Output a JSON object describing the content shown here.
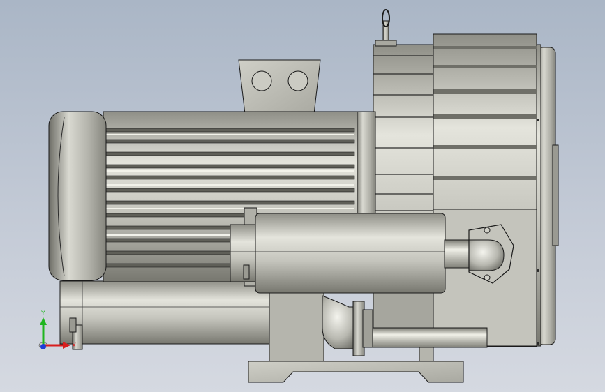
{
  "viewport": {
    "background_top": "#aab6c6",
    "background_bottom": "#d5d9e1"
  },
  "model": {
    "body_color": "#bdbdb5",
    "edge_color": "#1a1a1a"
  },
  "triad": {
    "x_label": "X",
    "y_label": "Y",
    "x_color": "#d81e1e",
    "y_color": "#1fb51f",
    "z_color": "#1e3cd8"
  }
}
